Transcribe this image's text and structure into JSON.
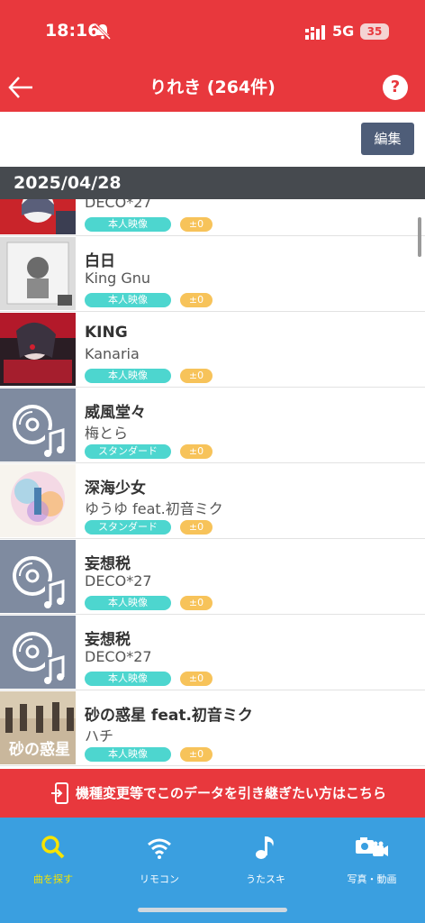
{
  "status": {
    "time": "18:16",
    "network": "5G",
    "battery": "35"
  },
  "header": {
    "title": "りれき (264件)"
  },
  "toolbar": {
    "edit_label": "編集"
  },
  "date": "2025/04/28",
  "songs": [
    {
      "title": "",
      "artist": "DECO*27",
      "video": "本人映像",
      "key": "±0"
    },
    {
      "title": "白日",
      "artist": "King Gnu",
      "video": "本人映像",
      "key": "±0"
    },
    {
      "title": "KING",
      "artist": "Kanaria",
      "video": "本人映像",
      "key": "±0"
    },
    {
      "title": "威風堂々",
      "artist": "梅とら",
      "video": "スタンダード",
      "key": "±0"
    },
    {
      "title": "深海少女",
      "artist": "ゆうゆ feat.初音ミク",
      "video": "スタンダード",
      "key": "±0"
    },
    {
      "title": "妄想税",
      "artist": "DECO*27",
      "video": "本人映像",
      "key": "±0"
    },
    {
      "title": "妄想税",
      "artist": "DECO*27",
      "video": "本人映像",
      "key": "±0"
    },
    {
      "title": "砂の惑星 feat.初音ミク",
      "artist": "ハチ",
      "video": "本人映像",
      "key": "±0"
    }
  ],
  "thumb_text": {
    "row7": "砂の惑星"
  },
  "banner": {
    "label": "機種変更等でこのデータを引き継ぎたい方はこちら"
  },
  "tabs": [
    {
      "label": "曲を探す",
      "icon": "search-icon"
    },
    {
      "label": "リモコン",
      "icon": "wifi-icon"
    },
    {
      "label": "うたスキ",
      "icon": "music-note-icon"
    },
    {
      "label": "写真・動画",
      "icon": "camera-icon"
    }
  ],
  "colors": {
    "accent": "#e8383d",
    "tabbar": "#3a9fe0",
    "active_tab": "#f7e400",
    "video_badge": "#4dd6cf",
    "key_badge": "#f7c35a"
  }
}
